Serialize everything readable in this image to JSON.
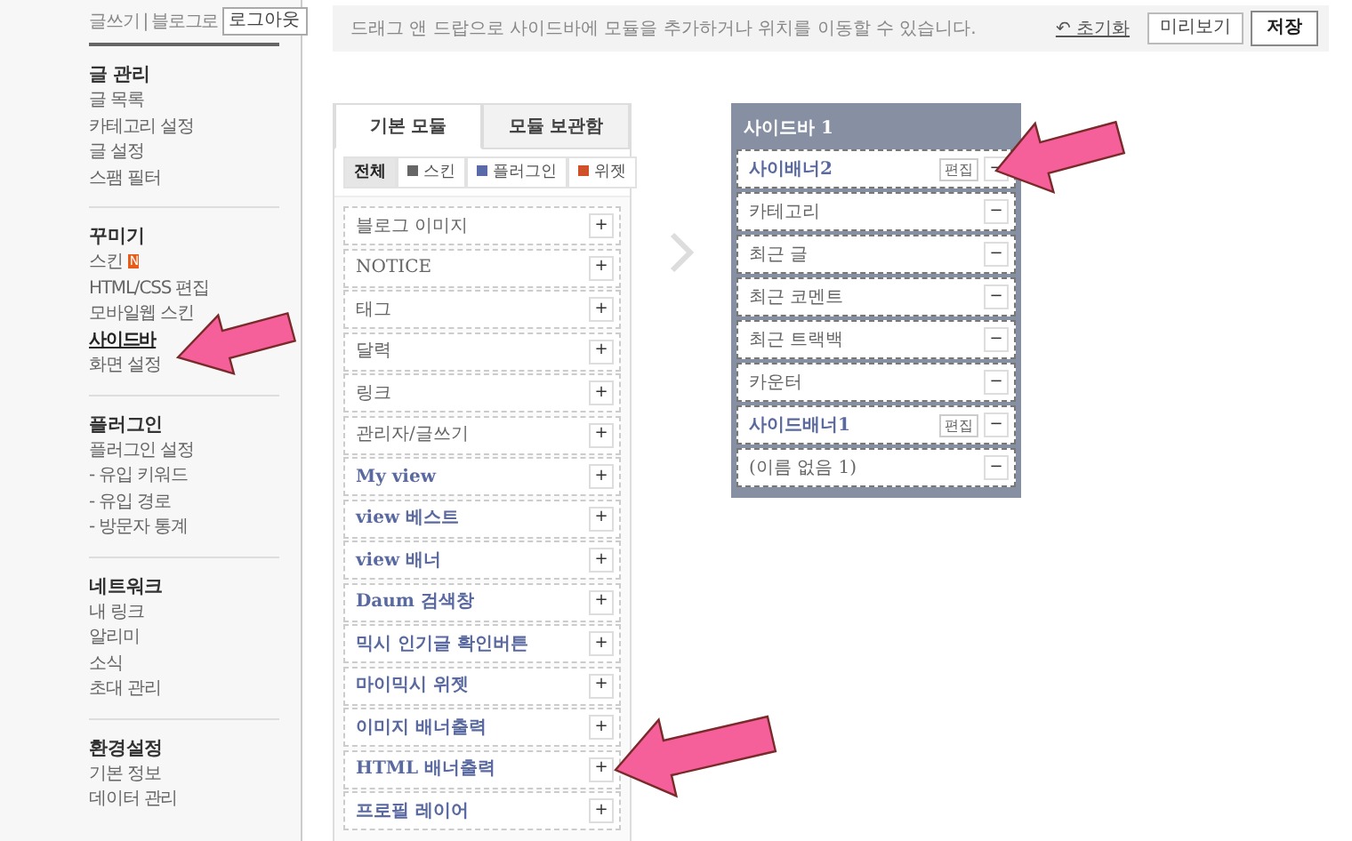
{
  "nav_top": {
    "links": [
      "글쓰기",
      "블로그로"
    ],
    "separator": "|",
    "logout_button": "로그아웃"
  },
  "nav_sections": [
    {
      "title": "글 관리",
      "items": [
        {
          "label": "글 목록",
          "selected": false
        },
        {
          "label": "카테고리 설정",
          "selected": false
        },
        {
          "label": "글 설정",
          "selected": false
        },
        {
          "label": "스팸 필터",
          "selected": false
        }
      ]
    },
    {
      "title": "꾸미기",
      "items": [
        {
          "label": "스킨",
          "selected": false,
          "badge": "N"
        },
        {
          "label": "HTML/CSS 편집",
          "selected": false
        },
        {
          "label": "모바일웹 스킨",
          "selected": false
        },
        {
          "label": "사이드바",
          "selected": true
        },
        {
          "label": "화면 설정",
          "selected": false
        }
      ]
    },
    {
      "title": "플러그인",
      "items": [
        {
          "label": "플러그인 설정",
          "selected": false
        },
        {
          "label": "- 유입 키워드",
          "selected": false
        },
        {
          "label": "- 유입 경로",
          "selected": false
        },
        {
          "label": "- 방문자 통계",
          "selected": false
        }
      ]
    },
    {
      "title": "네트워크",
      "items": [
        {
          "label": "내 링크",
          "selected": false
        },
        {
          "label": "알리미",
          "selected": false
        },
        {
          "label": "소식",
          "selected": false
        },
        {
          "label": "초대 관리",
          "selected": false
        }
      ]
    },
    {
      "title": "환경설정",
      "items": [
        {
          "label": "기본 정보",
          "selected": false
        },
        {
          "label": "데이터 관리",
          "selected": false
        }
      ]
    }
  ],
  "info_bar": {
    "message": "드래그 앤 드랍으로 사이드바에 모듈을 추가하거나 위치를 이동할 수 있습니다.",
    "reset_icon": "↶",
    "reset_link": "초기화",
    "buttons": [
      {
        "label": "미리보기",
        "kind": "normal"
      },
      {
        "label": "저장",
        "kind": "primary"
      }
    ]
  },
  "module_tabs": [
    {
      "label": "기본 모듈",
      "selected": true
    },
    {
      "label": "모듈 보관함",
      "selected": false
    }
  ],
  "filters": [
    {
      "label": "전체",
      "selected": true
    },
    {
      "label": "스킨",
      "selected": false,
      "color": "#666666"
    },
    {
      "label": "플러그인",
      "selected": false,
      "color": "#5a6aa8"
    },
    {
      "label": "위젯",
      "selected": false,
      "color": "#d0502a"
    }
  ],
  "modules": [
    {
      "label": "블로그 이미지",
      "kind": "skin",
      "action": "+"
    },
    {
      "label": "NOTICE",
      "kind": "skin",
      "action": "+"
    },
    {
      "label": "태그",
      "kind": "skin",
      "action": "+"
    },
    {
      "label": "달력",
      "kind": "skin",
      "action": "+"
    },
    {
      "label": "링크",
      "kind": "skin",
      "action": "+"
    },
    {
      "label": "관리자/글쓰기",
      "kind": "skin",
      "action": "+"
    },
    {
      "label": "My view",
      "kind": "plugin",
      "action": "+"
    },
    {
      "label": "view 베스트",
      "kind": "plugin",
      "action": "+"
    },
    {
      "label": "view 배너",
      "kind": "plugin",
      "action": "+"
    },
    {
      "label": "Daum 검색창",
      "kind": "plugin",
      "action": "+"
    },
    {
      "label": "믹시 인기글 확인버튼",
      "kind": "plugin",
      "action": "+"
    },
    {
      "label": "마이믹시 위젯",
      "kind": "plugin",
      "action": "+"
    },
    {
      "label": "이미지 배너출력",
      "kind": "plugin",
      "action": "+"
    },
    {
      "label": "HTML 배너출력",
      "kind": "plugin",
      "action": "+"
    },
    {
      "label": "프로필 레이어",
      "kind": "plugin",
      "action": "+"
    }
  ],
  "sidebar": {
    "title": "사이드바 1",
    "modules": [
      {
        "label": "사이배너2",
        "kind": "plugin",
        "edit": "편집",
        "action": "−"
      },
      {
        "label": "카테고리",
        "kind": "skin",
        "action": "−"
      },
      {
        "label": "최근 글",
        "kind": "skin",
        "action": "−"
      },
      {
        "label": "최근 코멘트",
        "kind": "skin",
        "action": "−"
      },
      {
        "label": "최근 트랙백",
        "kind": "skin",
        "action": "−"
      },
      {
        "label": "카운터",
        "kind": "skin",
        "action": "−"
      },
      {
        "label": "사이드배너1",
        "kind": "plugin",
        "edit": "편집",
        "action": "−"
      },
      {
        "label": "(이름 없음 1)",
        "kind": "skin",
        "action": "−"
      }
    ]
  }
}
